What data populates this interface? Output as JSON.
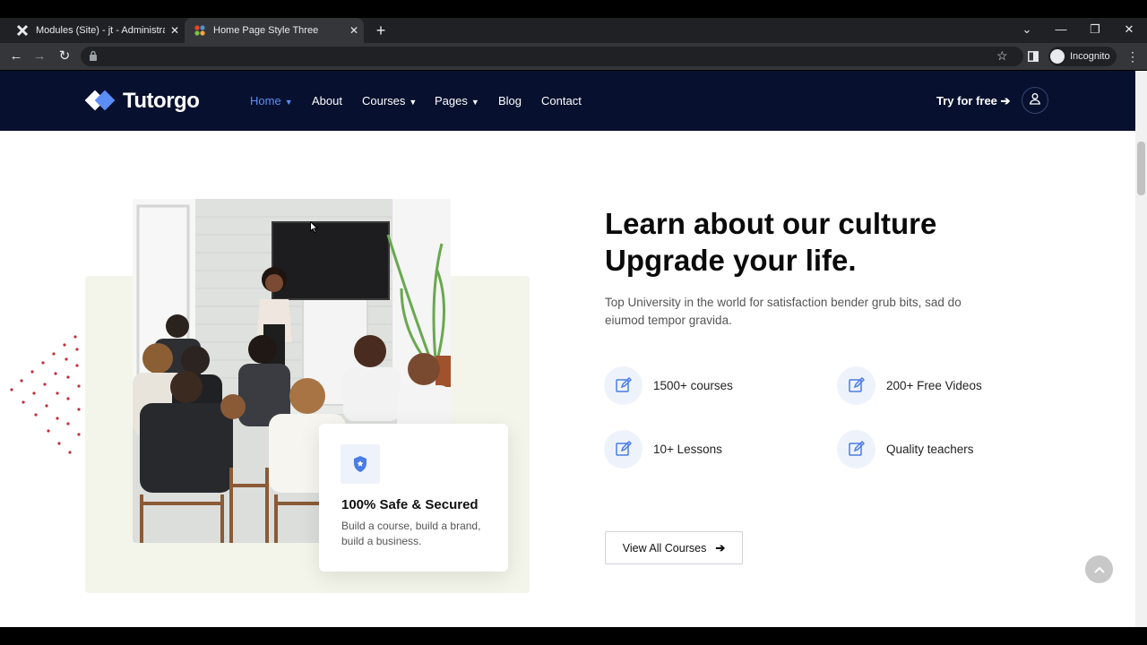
{
  "browser": {
    "tabs": [
      {
        "title": "Modules (Site) - jt - Administratio",
        "active": false
      },
      {
        "title": "Home Page Style Three",
        "active": true
      }
    ],
    "new_tab_icon": "plus-icon",
    "incognito_label": "Incognito"
  },
  "site": {
    "logo_text": "Tutorgo",
    "nav": [
      {
        "label": "Home",
        "dropdown": true,
        "current": true
      },
      {
        "label": "About",
        "dropdown": false
      },
      {
        "label": "Courses",
        "dropdown": true
      },
      {
        "label": "Pages",
        "dropdown": true
      },
      {
        "label": "Blog",
        "dropdown": false
      },
      {
        "label": "Contact",
        "dropdown": false
      }
    ],
    "try_free": "Try for free",
    "colors": {
      "header_bg": "#07102e",
      "accent": "#5b8df6",
      "panel_bg": "#f4f5ea"
    }
  },
  "about": {
    "heading_line1": "Learn about our culture",
    "heading_line2": "Upgrade your life.",
    "lead": "Top University in the world for satisfaction bender grub bits, sad do eiumod tempor gravida.",
    "features": [
      {
        "label": "1500+ courses",
        "icon": "edit-icon"
      },
      {
        "label": "200+ Free Videos",
        "icon": "edit-icon"
      },
      {
        "label": "10+ Lessons",
        "icon": "edit-icon"
      },
      {
        "label": "Quality teachers",
        "icon": "edit-icon"
      }
    ],
    "button": "View All Courses",
    "card": {
      "title": "100% Safe & Secured",
      "desc": "Build a course, build a brand, build a business."
    }
  }
}
